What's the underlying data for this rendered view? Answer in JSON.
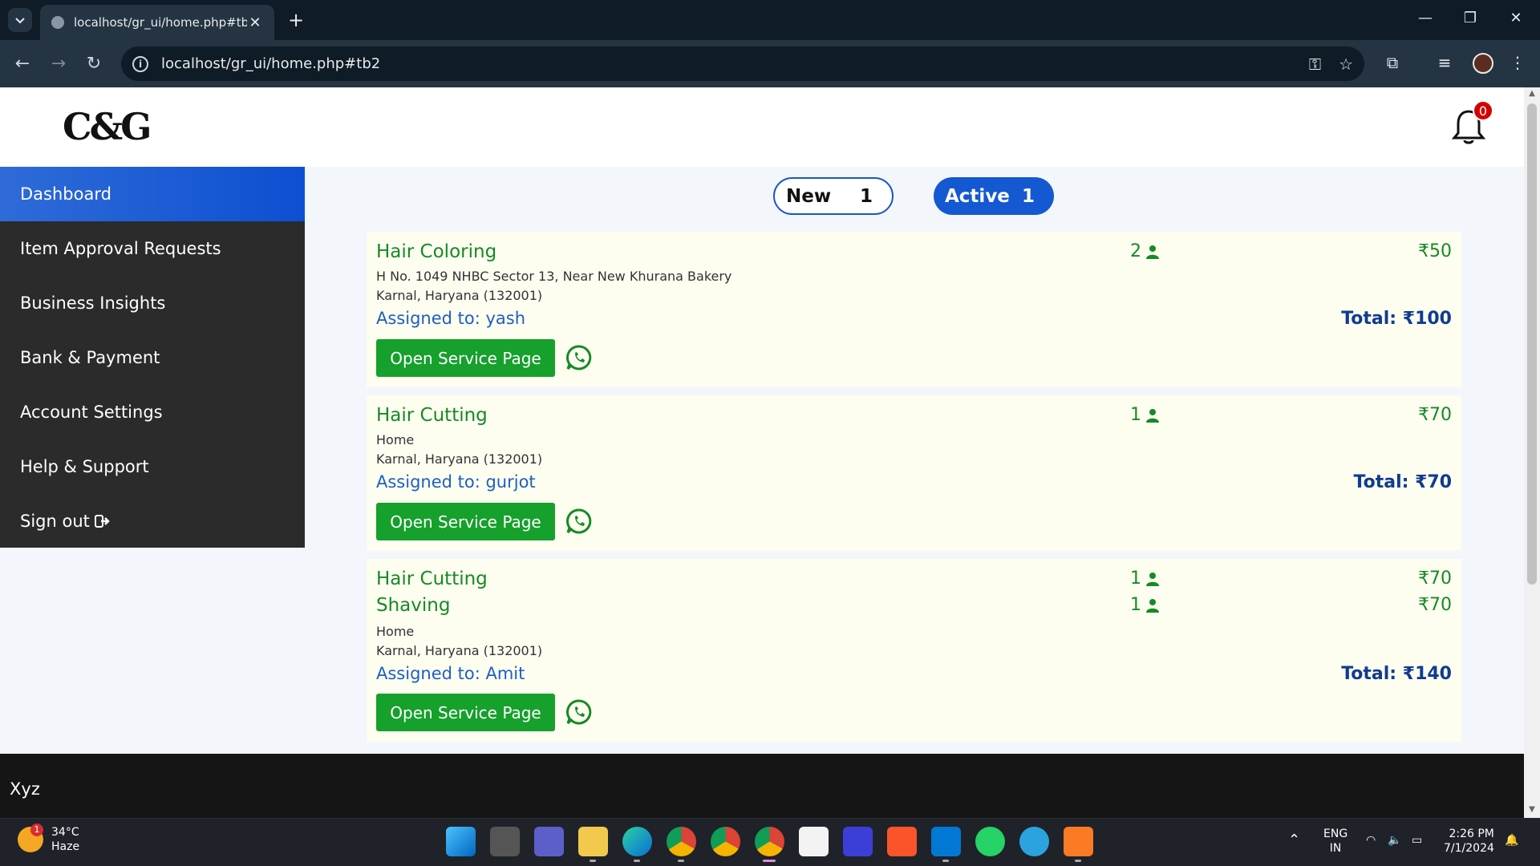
{
  "browser": {
    "tab_title": "localhost/gr_ui/home.php#tb2",
    "url": "localhost/gr_ui/home.php#tb2"
  },
  "header": {
    "logo_text": "C&G",
    "notification_count": "0"
  },
  "sidebar": {
    "items": [
      {
        "label": "Dashboard"
      },
      {
        "label": "Item Approval Requests"
      },
      {
        "label": "Business Insights"
      },
      {
        "label": "Bank & Payment"
      },
      {
        "label": "Account Settings"
      },
      {
        "label": "Help & Support"
      },
      {
        "label": "Sign out"
      }
    ]
  },
  "tabs": {
    "new": {
      "label": "New",
      "count": "1"
    },
    "active": {
      "label": "Active",
      "count": "1"
    }
  },
  "orders": [
    {
      "services": [
        {
          "name": "Hair Coloring",
          "qty": "2",
          "price": "₹50"
        }
      ],
      "address_line1": "H No. 1049 NHBC Sector 13, Near New Khurana Bakery",
      "address_line2": "Karnal, Haryana (132001)",
      "assigned": "Assigned to: yash",
      "total": "Total: ₹100",
      "button": "Open Service Page"
    },
    {
      "services": [
        {
          "name": "Hair Cutting",
          "qty": "1",
          "price": "₹70"
        }
      ],
      "address_line1": "Home",
      "address_line2": "Karnal, Haryana (132001)",
      "assigned": "Assigned to: gurjot",
      "total": "Total: ₹70",
      "button": "Open Service Page"
    },
    {
      "services": [
        {
          "name": "Hair Cutting",
          "qty": "1",
          "price": "₹70"
        },
        {
          "name": "Shaving",
          "qty": "1",
          "price": "₹70"
        }
      ],
      "address_line1": "Home",
      "address_line2": "Karnal, Haryana (132001)",
      "assigned": "Assigned to: Amit",
      "total": "Total: ₹140",
      "button": "Open Service Page"
    }
  ],
  "footer": {
    "text": "Xyz"
  },
  "taskbar": {
    "weather_temp": "34°C",
    "weather_desc": "Haze",
    "weather_badge": "1",
    "lang_line1": "ENG",
    "lang_line2": "IN",
    "time": "2:26 PM",
    "date": "7/1/2024"
  },
  "colors": {
    "accent_blue": "#1458d2",
    "service_green": "#168a24",
    "button_green": "#16a02c",
    "total_blue": "#0f3c8f",
    "card_bg": "#fdfdf0",
    "sidebar_bg": "#2b2b2b"
  }
}
